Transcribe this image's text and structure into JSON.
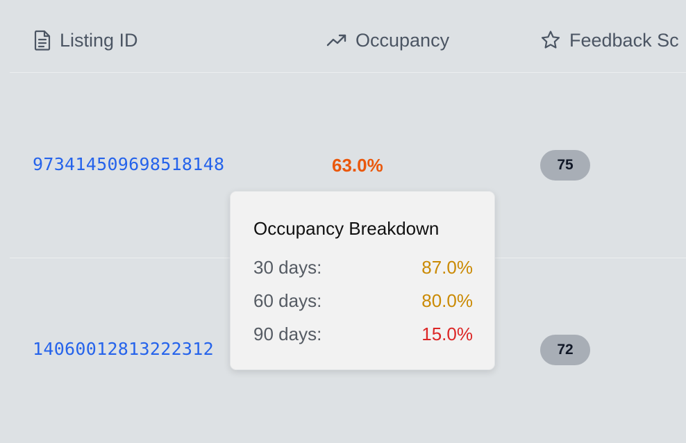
{
  "columns": [
    {
      "label": "Listing ID",
      "icon": "document-icon"
    },
    {
      "label": "Occupancy",
      "icon": "trending-up-icon"
    },
    {
      "label": "Feedback Sc",
      "icon": "star-icon"
    }
  ],
  "rows": [
    {
      "listing_id": "97341450969851814​8",
      "occupancy": "63.0%",
      "occupancy_color": "#ea580c",
      "score": "75"
    },
    {
      "listing_id": "14060012813222312",
      "score": "72"
    }
  ],
  "tooltip": {
    "title": "Occupancy Breakdown",
    "items": [
      {
        "label": "30 days:",
        "value": "87.0%",
        "color": "#ca8a04"
      },
      {
        "label": "60 days:",
        "value": "80.0%",
        "color": "#ca8a04"
      },
      {
        "label": "90 days:",
        "value": "15.0%",
        "color": "#dc2626"
      }
    ]
  },
  "colors": {
    "background": "#dde1e4",
    "link": "#2563eb",
    "badge": "#a8aeb6"
  }
}
